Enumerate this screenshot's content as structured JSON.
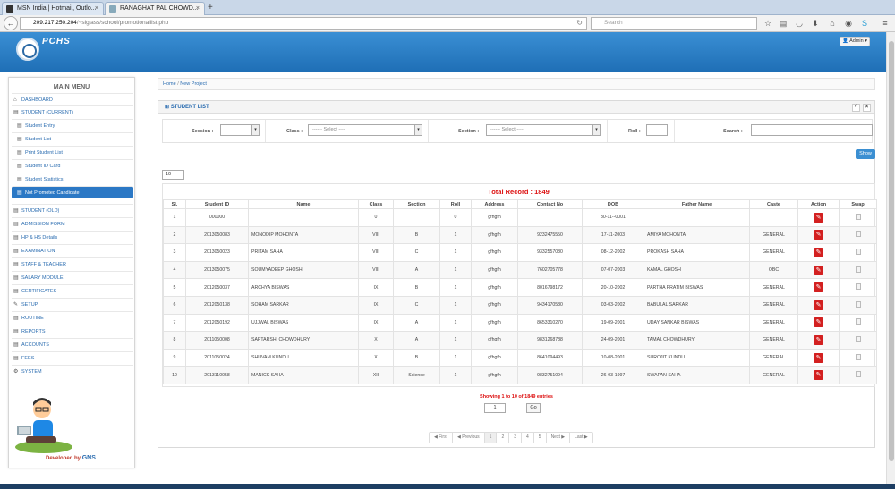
{
  "browser": {
    "tabs": [
      {
        "title": "MSN India | Hotmail, Outlo...",
        "active": false
      },
      {
        "title": "RANAGHAT PAL CHOWD...",
        "active": true
      }
    ],
    "url_host": "209.217.250.204",
    "url_path": "/~siglass/school/promotionallist.php",
    "search_placeholder": "Search"
  },
  "header": {
    "brand": "PCHS",
    "admin_label": "Admin"
  },
  "sidebar": {
    "title": "MAIN MENU",
    "items": [
      {
        "label": "DASHBOARD",
        "icon": "home-icon",
        "sub": false
      },
      {
        "label": "STUDENT (CURRENT)",
        "icon": "list-icon",
        "sub": false
      },
      {
        "label": "Student Entry",
        "icon": "list-icon",
        "sub": true
      },
      {
        "label": "Student List",
        "icon": "list-icon",
        "sub": true
      },
      {
        "label": "Print Student List",
        "icon": "list-icon",
        "sub": true
      },
      {
        "label": "Student ID Card",
        "icon": "list-icon",
        "sub": true
      },
      {
        "label": "Student Statistics",
        "icon": "list-icon",
        "sub": true
      },
      {
        "label": "Not Promoted Candidate",
        "icon": "list-icon",
        "sub": true,
        "active": true
      },
      {
        "label": "STUDENT (OLD)",
        "icon": "list-icon",
        "sub": false
      },
      {
        "label": "ADMISSION FORM",
        "icon": "list-icon",
        "sub": false
      },
      {
        "label": "HP & HS Details",
        "icon": "list-icon",
        "sub": false
      },
      {
        "label": "EXAMINATION",
        "icon": "list-icon",
        "sub": false
      },
      {
        "label": "STAFF & TEACHER",
        "icon": "list-icon",
        "sub": false
      },
      {
        "label": "SALARY MODULE",
        "icon": "list-icon",
        "sub": false
      },
      {
        "label": "CERTIFICATES",
        "icon": "list-icon",
        "sub": false
      },
      {
        "label": "SETUP",
        "icon": "wrench-icon",
        "sub": false
      },
      {
        "label": "ROUTINE",
        "icon": "list-icon",
        "sub": false
      },
      {
        "label": "REPORTS",
        "icon": "list-icon",
        "sub": false
      },
      {
        "label": "ACCOUNTS",
        "icon": "list-icon",
        "sub": false
      },
      {
        "label": "FEES",
        "icon": "list-icon",
        "sub": false
      },
      {
        "label": "SYSTEM",
        "icon": "gears-icon",
        "sub": false
      }
    ],
    "dev_by": "Developed by",
    "dev_brand": "GNS"
  },
  "breadcrumb": {
    "home": "Home",
    "sep": "/",
    "current": "New Project"
  },
  "panel": {
    "title": "STUDENT LIST",
    "filters": {
      "session_label": "Session :",
      "class_label": "Class :",
      "class_value": "------ Select ----",
      "section_label": "Section :",
      "section_value": "------ Select ----",
      "roll_label": "Roll :",
      "search_label": "Search :"
    },
    "show_label": "Show",
    "per_page": "10",
    "total_record": "Total Record : 1849",
    "columns": [
      "Sl.",
      "Student ID",
      "Name",
      "Class",
      "Section",
      "Roll",
      "Address",
      "Contact No",
      "DOB",
      "Father Name",
      "Caste",
      "Action",
      "Swap"
    ],
    "rows": [
      [
        "1",
        "000000",
        "",
        "0",
        "",
        "0",
        "gfhgfh",
        "",
        "30-11--0001",
        "",
        "",
        "",
        ""
      ],
      [
        "2",
        "2013050083",
        "MONODIP MOHONTA",
        "VIII",
        "B",
        "1",
        "gfhgfh",
        "9232475550",
        "17-11-2003",
        "AMIYA MOHONTA",
        "GENERAL",
        "",
        ""
      ],
      [
        "3",
        "2013050023",
        "PRITAM SAHA",
        "VIII",
        "C",
        "1",
        "gfhgfh",
        "9332557080",
        "08-12-2002",
        "PROKASH SAHA",
        "GENERAL",
        "",
        ""
      ],
      [
        "4",
        "2013050075",
        "SOUMYADEEP GHOSH",
        "VIII",
        "A",
        "1",
        "gfhgfh",
        "7602705778",
        "07-07-2003",
        "KAMAL GHOSH",
        "OBC",
        "",
        ""
      ],
      [
        "5",
        "2012050037",
        "ARCHYA BISWAS",
        "IX",
        "B",
        "1",
        "gfhgfh",
        "8016798172",
        "20-10-2002",
        "PARTHA PRATIM BISWAS",
        "GENERAL",
        "",
        ""
      ],
      [
        "6",
        "2012050138",
        "SOHAM SARKAR",
        "IX",
        "C",
        "1",
        "gfhgfh",
        "9434170580",
        "03-03-2002",
        "BABULAL SARKAR",
        "GENERAL",
        "",
        ""
      ],
      [
        "7",
        "2012050192",
        "UJJWAL BISWAS",
        "IX",
        "A",
        "1",
        "gfhgfh",
        "8653310270",
        "19-09-2001",
        "UDAY SANKAR BISWAS",
        "GENERAL",
        "",
        ""
      ],
      [
        "8",
        "2011050008",
        "SAPTARSHI CHOWDHURY",
        "X",
        "A",
        "1",
        "gfhgfh",
        "9831268788",
        "24-09-2001",
        "TAMAL CHOWDHURY",
        "GENERAL",
        "",
        ""
      ],
      [
        "9",
        "2011050024",
        "SHUVAM KUNDU",
        "X",
        "B",
        "1",
        "gfhgfh",
        "8641094493",
        "10-08-2001",
        "SUROJIT KUNDU",
        "GENERAL",
        "",
        ""
      ],
      [
        "10",
        "2013110058",
        "MANICK SAHA",
        "XII",
        "Science",
        "1",
        "gfhgfh",
        "9832751094",
        "26-03-1997",
        "SWAPAN SAHA",
        "GENERAL",
        "",
        ""
      ]
    ],
    "showing": "Showing 1 to 10 of 1849 entries",
    "page_input": "1",
    "go_label": "Go",
    "pager": [
      "First",
      "Previous",
      "1",
      "2",
      "3",
      "4",
      "5",
      "Next",
      "Last"
    ]
  }
}
